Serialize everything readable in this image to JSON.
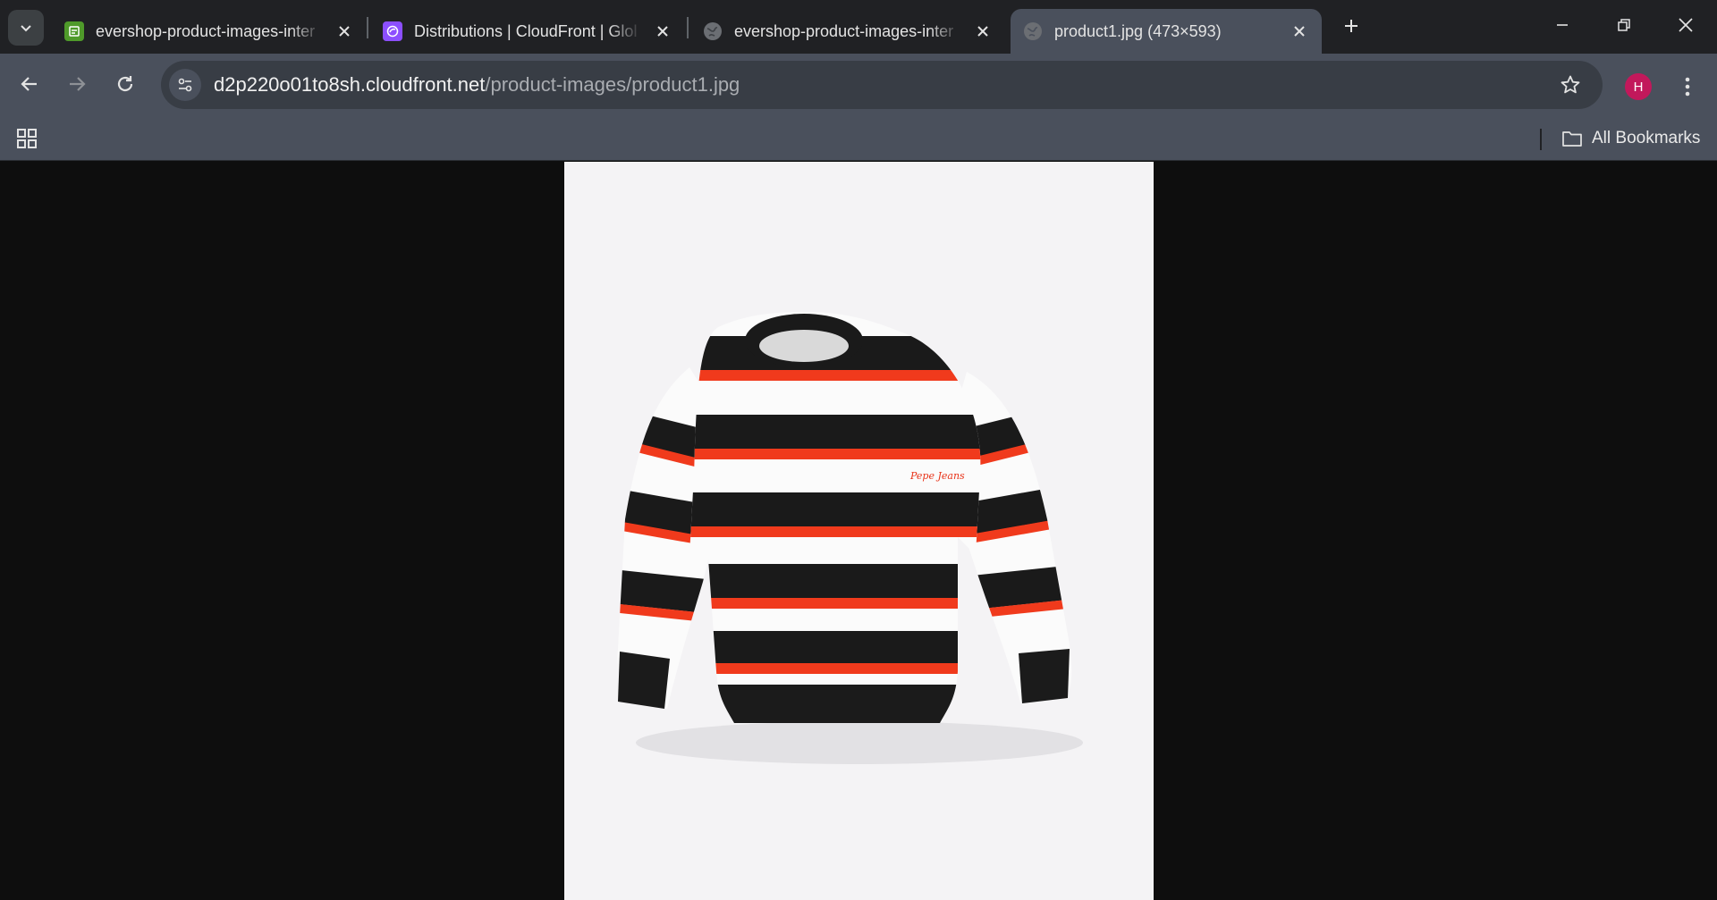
{
  "tabs": [
    {
      "title": "evershop-product-images-inter",
      "favicon": "s3-bucket-icon",
      "favicon_color": "#4f9a2a",
      "active": false
    },
    {
      "title": "Distributions | CloudFront | Glol",
      "favicon": "cloudfront-icon",
      "favicon_color": "#8c4fff",
      "active": false
    },
    {
      "title": "evershop-product-images-inter",
      "favicon": "globe-icon",
      "favicon_color": "#6b6e73",
      "active": false
    },
    {
      "title": "product1.jpg (473×593)",
      "favicon": "globe-icon",
      "favicon_color": "#6b6e73",
      "active": true
    }
  ],
  "address_bar": {
    "host": "d2p220o01to8sh.cloudfront.net",
    "path": "/product-images/product1.jpg"
  },
  "profile": {
    "initial": "H",
    "color": "#c2185b"
  },
  "bookmarks_bar": {
    "all_bookmarks_label": "All Bookmarks"
  },
  "image": {
    "description_name": "striped-sweater-image",
    "logo_text": "Pepe Jeans"
  }
}
